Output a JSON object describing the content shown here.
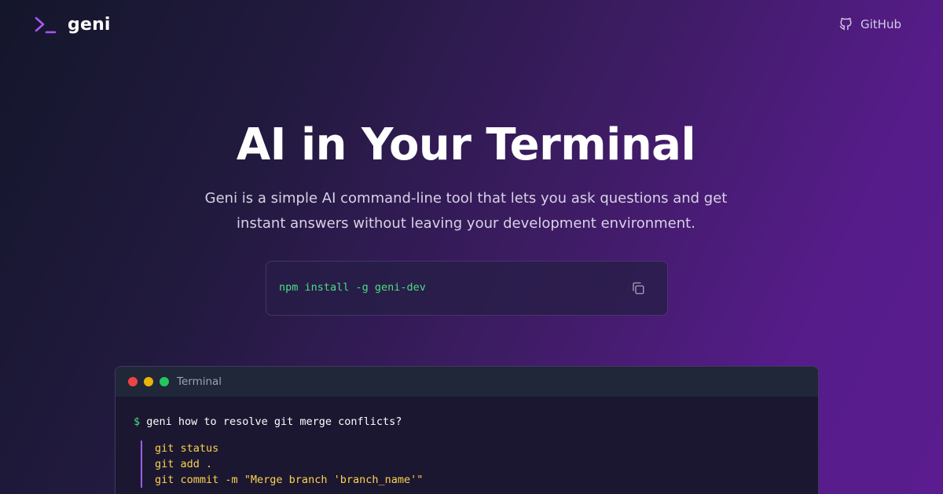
{
  "nav": {
    "logo_text": "geni",
    "github_label": "GitHub"
  },
  "hero": {
    "title": "AI in Your Terminal",
    "subtitle": "Geni is a simple AI command-line tool that lets you ask questions and get instant answers without leaving your development environment."
  },
  "install": {
    "command": "npm install -g geni-dev",
    "copy_icon": "copy-icon"
  },
  "terminal": {
    "title": "Terminal",
    "prompt_symbol": "$",
    "prompt_command": "geni how to resolve git merge conflicts?",
    "answer_lines": [
      "git status",
      "git add .",
      "git commit -m \"Merge branch 'branch_name'\""
    ]
  },
  "colors": {
    "accent_purple": "#a855f7",
    "command_green": "#4ade80",
    "answer_yellow": "#fcd34d",
    "dot_red": "#ef4444",
    "dot_yellow": "#eab308",
    "dot_green": "#22c55e"
  }
}
